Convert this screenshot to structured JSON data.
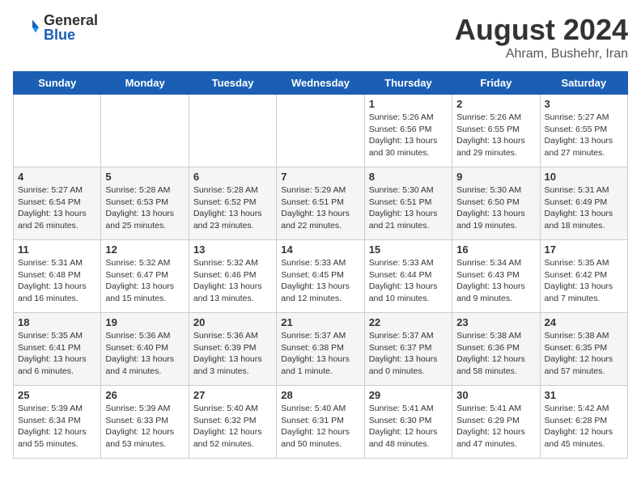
{
  "logo": {
    "general": "General",
    "blue": "Blue"
  },
  "title": {
    "month_year": "August 2024",
    "location": "Ahram, Bushehr, Iran"
  },
  "days_of_week": [
    "Sunday",
    "Monday",
    "Tuesday",
    "Wednesday",
    "Thursday",
    "Friday",
    "Saturday"
  ],
  "weeks": [
    [
      {
        "day": "",
        "info": ""
      },
      {
        "day": "",
        "info": ""
      },
      {
        "day": "",
        "info": ""
      },
      {
        "day": "",
        "info": ""
      },
      {
        "day": "1",
        "info": "Sunrise: 5:26 AM\nSunset: 6:56 PM\nDaylight: 13 hours\nand 30 minutes."
      },
      {
        "day": "2",
        "info": "Sunrise: 5:26 AM\nSunset: 6:55 PM\nDaylight: 13 hours\nand 29 minutes."
      },
      {
        "day": "3",
        "info": "Sunrise: 5:27 AM\nSunset: 6:55 PM\nDaylight: 13 hours\nand 27 minutes."
      }
    ],
    [
      {
        "day": "4",
        "info": "Sunrise: 5:27 AM\nSunset: 6:54 PM\nDaylight: 13 hours\nand 26 minutes."
      },
      {
        "day": "5",
        "info": "Sunrise: 5:28 AM\nSunset: 6:53 PM\nDaylight: 13 hours\nand 25 minutes."
      },
      {
        "day": "6",
        "info": "Sunrise: 5:28 AM\nSunset: 6:52 PM\nDaylight: 13 hours\nand 23 minutes."
      },
      {
        "day": "7",
        "info": "Sunrise: 5:29 AM\nSunset: 6:51 PM\nDaylight: 13 hours\nand 22 minutes."
      },
      {
        "day": "8",
        "info": "Sunrise: 5:30 AM\nSunset: 6:51 PM\nDaylight: 13 hours\nand 21 minutes."
      },
      {
        "day": "9",
        "info": "Sunrise: 5:30 AM\nSunset: 6:50 PM\nDaylight: 13 hours\nand 19 minutes."
      },
      {
        "day": "10",
        "info": "Sunrise: 5:31 AM\nSunset: 6:49 PM\nDaylight: 13 hours\nand 18 minutes."
      }
    ],
    [
      {
        "day": "11",
        "info": "Sunrise: 5:31 AM\nSunset: 6:48 PM\nDaylight: 13 hours\nand 16 minutes."
      },
      {
        "day": "12",
        "info": "Sunrise: 5:32 AM\nSunset: 6:47 PM\nDaylight: 13 hours\nand 15 minutes."
      },
      {
        "day": "13",
        "info": "Sunrise: 5:32 AM\nSunset: 6:46 PM\nDaylight: 13 hours\nand 13 minutes."
      },
      {
        "day": "14",
        "info": "Sunrise: 5:33 AM\nSunset: 6:45 PM\nDaylight: 13 hours\nand 12 minutes."
      },
      {
        "day": "15",
        "info": "Sunrise: 5:33 AM\nSunset: 6:44 PM\nDaylight: 13 hours\nand 10 minutes."
      },
      {
        "day": "16",
        "info": "Sunrise: 5:34 AM\nSunset: 6:43 PM\nDaylight: 13 hours\nand 9 minutes."
      },
      {
        "day": "17",
        "info": "Sunrise: 5:35 AM\nSunset: 6:42 PM\nDaylight: 13 hours\nand 7 minutes."
      }
    ],
    [
      {
        "day": "18",
        "info": "Sunrise: 5:35 AM\nSunset: 6:41 PM\nDaylight: 13 hours\nand 6 minutes."
      },
      {
        "day": "19",
        "info": "Sunrise: 5:36 AM\nSunset: 6:40 PM\nDaylight: 13 hours\nand 4 minutes."
      },
      {
        "day": "20",
        "info": "Sunrise: 5:36 AM\nSunset: 6:39 PM\nDaylight: 13 hours\nand 3 minutes."
      },
      {
        "day": "21",
        "info": "Sunrise: 5:37 AM\nSunset: 6:38 PM\nDaylight: 13 hours\nand 1 minute."
      },
      {
        "day": "22",
        "info": "Sunrise: 5:37 AM\nSunset: 6:37 PM\nDaylight: 13 hours\nand 0 minutes."
      },
      {
        "day": "23",
        "info": "Sunrise: 5:38 AM\nSunset: 6:36 PM\nDaylight: 12 hours\nand 58 minutes."
      },
      {
        "day": "24",
        "info": "Sunrise: 5:38 AM\nSunset: 6:35 PM\nDaylight: 12 hours\nand 57 minutes."
      }
    ],
    [
      {
        "day": "25",
        "info": "Sunrise: 5:39 AM\nSunset: 6:34 PM\nDaylight: 12 hours\nand 55 minutes."
      },
      {
        "day": "26",
        "info": "Sunrise: 5:39 AM\nSunset: 6:33 PM\nDaylight: 12 hours\nand 53 minutes."
      },
      {
        "day": "27",
        "info": "Sunrise: 5:40 AM\nSunset: 6:32 PM\nDaylight: 12 hours\nand 52 minutes."
      },
      {
        "day": "28",
        "info": "Sunrise: 5:40 AM\nSunset: 6:31 PM\nDaylight: 12 hours\nand 50 minutes."
      },
      {
        "day": "29",
        "info": "Sunrise: 5:41 AM\nSunset: 6:30 PM\nDaylight: 12 hours\nand 48 minutes."
      },
      {
        "day": "30",
        "info": "Sunrise: 5:41 AM\nSunset: 6:29 PM\nDaylight: 12 hours\nand 47 minutes."
      },
      {
        "day": "31",
        "info": "Sunrise: 5:42 AM\nSunset: 6:28 PM\nDaylight: 12 hours\nand 45 minutes."
      }
    ]
  ]
}
